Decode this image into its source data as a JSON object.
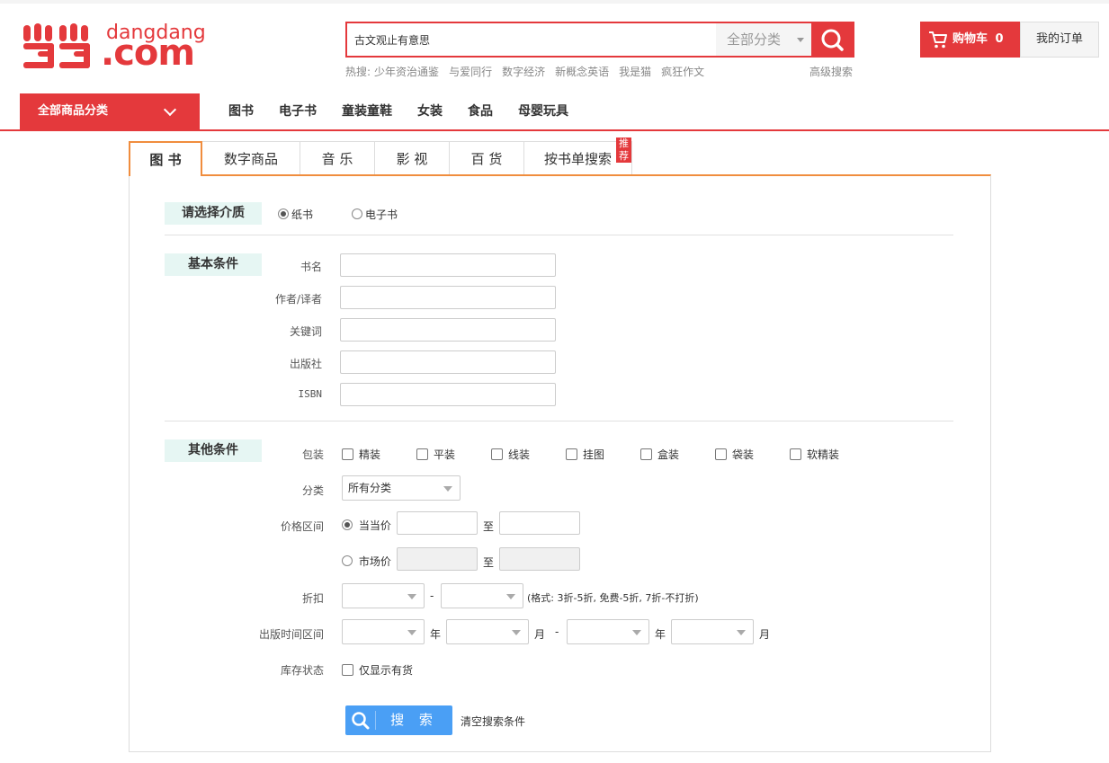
{
  "logo": {
    "top_text": "dangdang",
    "main_text": ".com"
  },
  "search": {
    "value": "古文观止有意思",
    "category": "全部分类",
    "hot_label": "热搜:",
    "hot": [
      "少年资治通鉴",
      "与爱同行",
      "数字经济",
      "新概念英语",
      "我是猫",
      "疯狂作文"
    ],
    "advanced": "高级搜索"
  },
  "cart": {
    "label": "购物车",
    "count": "0",
    "orders": "我的订单"
  },
  "nav": {
    "all": "全部商品分类",
    "links": [
      "图书",
      "电子书",
      "童装童鞋",
      "女装",
      "食品",
      "母婴玩具"
    ]
  },
  "tabs": [
    "图 书",
    "数字商品",
    "音 乐",
    "影 视",
    "百 货",
    "按书单搜索"
  ],
  "tab_badge": "推荐",
  "medium": {
    "label": "请选择介质",
    "options": [
      "纸书",
      "电子书"
    ],
    "selected": "纸书"
  },
  "basic": {
    "label": "基本条件",
    "fields": [
      "书名",
      "作者/译者",
      "关键词",
      "出版社",
      "ISBN"
    ]
  },
  "other": {
    "label": "其他条件",
    "binding_label": "包装",
    "bindings": [
      "精装",
      "平装",
      "线装",
      "挂图",
      "盒装",
      "袋装",
      "软精装"
    ],
    "category_label": "分类",
    "category_value": "所有分类",
    "price_label": "价格区间",
    "price_dd": "当当价",
    "price_market": "市场价",
    "to": "至",
    "discount_label": "折扣",
    "dash": "-",
    "discount_hint": "(格式: 3折-5折, 免费-5折, 7折-不打折)",
    "pubdate_label": "出版时间区间",
    "year": "年",
    "month": "月",
    "stock_label": "库存状态",
    "stock_option": "仅显示有货"
  },
  "actions": {
    "search": "搜 索",
    "clear": "清空搜索条件"
  },
  "colors": {
    "brand": "#e4393c",
    "tab_accent": "#f08d3e",
    "section_bg": "#e6f6f3",
    "button_blue": "#4a9ff5"
  }
}
